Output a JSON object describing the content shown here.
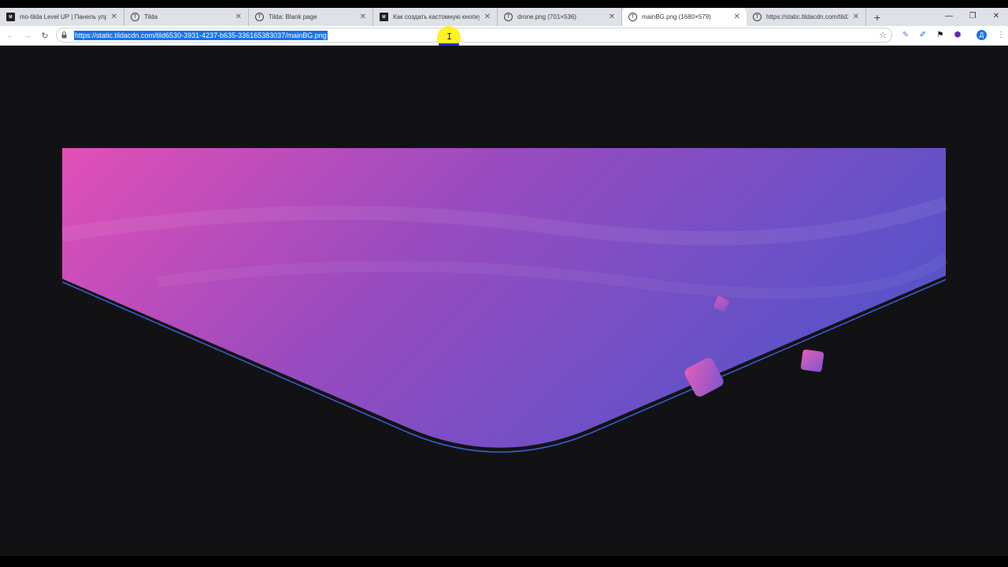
{
  "browser": {
    "tabs": [
      {
        "favicon": "dark-logo-icon",
        "title": "mo-tilda Level UP | Панель упра",
        "active": false
      },
      {
        "favicon": "tilda-icon",
        "title": "Tilda",
        "active": false
      },
      {
        "favicon": "tilda-icon",
        "title": "Tilda: Blank page",
        "active": false
      },
      {
        "favicon": "dark-logo-icon",
        "title": "Как создать кастомную кнопку",
        "active": false
      },
      {
        "favicon": "tilda-icon",
        "title": "drone.png (701×536)",
        "active": false
      },
      {
        "favicon": "tilda-icon",
        "title": "mainBG.png (1680×579)",
        "active": true
      },
      {
        "favicon": "tilda-icon",
        "title": "https://static.tildacdn.com/tild36",
        "active": false
      }
    ],
    "new_tab_label": "+",
    "address": {
      "url": "https://static.tildacdn.com/tild6530-3931-4237-b635-336165383037/mainBG.png",
      "selected": true
    },
    "profile_initial": "Д"
  },
  "content": {
    "image_name": "mainBG.png",
    "colors": {
      "page_bg": "#121214",
      "gradient_left": "#e24fb7",
      "gradient_mid": "#9a4bbf",
      "gradient_right": "#5a52c9",
      "outline": "#3a5fd0"
    }
  }
}
